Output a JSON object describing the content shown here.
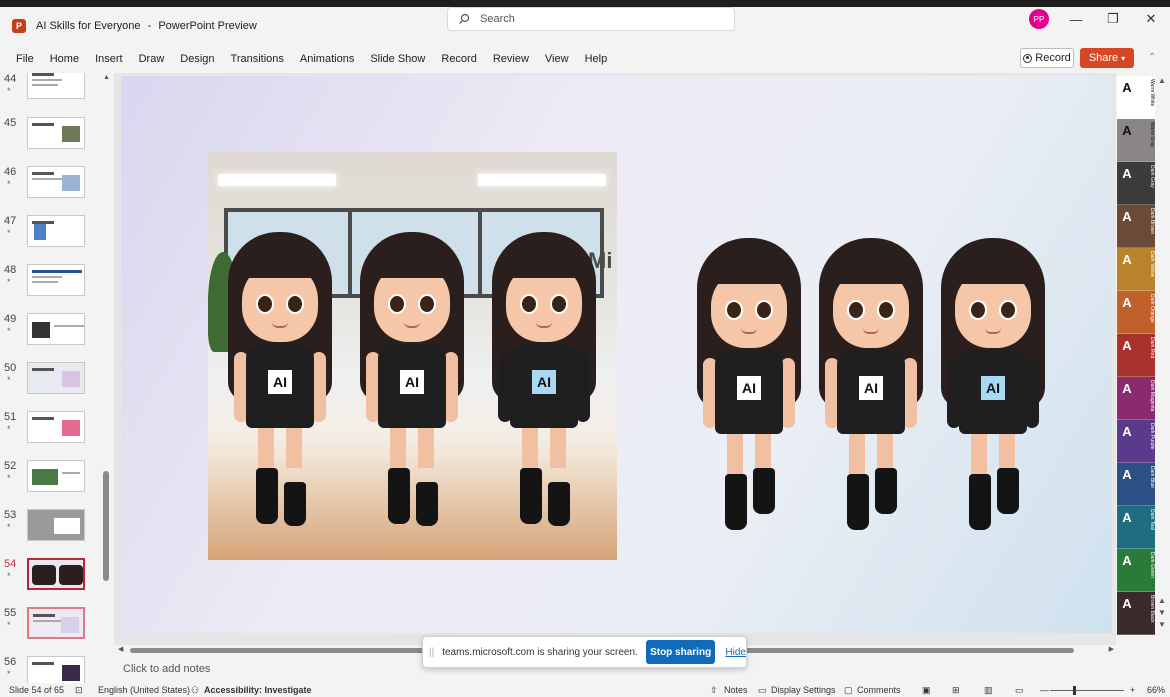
{
  "window": {
    "title": "AI Skills for Everyone",
    "separator": "-",
    "app_name": "PowerPoint Preview",
    "app_icon_letter": "P",
    "search_placeholder": "Search",
    "avatar_initials": "PP",
    "minimize": "—",
    "restore": "❐",
    "close": "✕"
  },
  "ribbon": {
    "tabs": [
      "File",
      "Home",
      "Insert",
      "Draw",
      "Design",
      "Transitions",
      "Animations",
      "Slide Show",
      "Record",
      "Review",
      "View",
      "Help"
    ],
    "record_label": "Record",
    "share_label": "Share",
    "accent": "#d64726"
  },
  "thumbnails": [
    {
      "num": "44",
      "star": "*"
    },
    {
      "num": "45",
      "star": ""
    },
    {
      "num": "46",
      "star": "*"
    },
    {
      "num": "47",
      "star": "*"
    },
    {
      "num": "48",
      "star": "*"
    },
    {
      "num": "49",
      "star": "*"
    },
    {
      "num": "50",
      "star": "*"
    },
    {
      "num": "51",
      "star": "*"
    },
    {
      "num": "52",
      "star": "*"
    },
    {
      "num": "53",
      "star": "*"
    },
    {
      "num": "54",
      "star": "*",
      "selected": true
    },
    {
      "num": "55",
      "star": "*"
    },
    {
      "num": "56",
      "star": "*"
    }
  ],
  "slide": {
    "photo_wall_text": "Mi",
    "logo_text": "AI",
    "figures_left": [
      "AI",
      "AI",
      "AI"
    ],
    "figures_right": [
      "AI",
      "AI",
      "AI"
    ]
  },
  "notes_placeholder": "Click to add notes",
  "share_bar": {
    "grip": "||",
    "message": "teams.microsoft.com is sharing your screen.",
    "stop_label": "Stop sharing",
    "hide_label": "Hide",
    "button_color": "#0f6cbd"
  },
  "swatches": [
    {
      "letter": "A",
      "bg": "#ffffff",
      "fg": "#111111",
      "label": "Warm White"
    },
    {
      "letter": "A",
      "bg": "#8a8686",
      "fg": "#111111",
      "label": "Warm Gray"
    },
    {
      "letter": "A",
      "bg": "#3b3b3b",
      "fg": "#ffffff",
      "label": "Dark Gray"
    },
    {
      "letter": "A",
      "bg": "#6b4a3a",
      "fg": "#ffffff",
      "label": "Dark Brown"
    },
    {
      "letter": "A",
      "bg": "#b8832b",
      "fg": "#ffffff",
      "label": "Dark Yellow"
    },
    {
      "letter": "A",
      "bg": "#c0612b",
      "fg": "#ffffff",
      "label": "Dark Orange"
    },
    {
      "letter": "A",
      "bg": "#a8322e",
      "fg": "#ffffff",
      "label": "Dark Red"
    },
    {
      "letter": "A",
      "bg": "#8a2b6e",
      "fg": "#ffffff",
      "label": "Dark Magenta"
    },
    {
      "letter": "A",
      "bg": "#5a3a8a",
      "fg": "#ffffff",
      "label": "Dark Purple"
    },
    {
      "letter": "A",
      "bg": "#2c4f86",
      "fg": "#ffffff",
      "label": "Dark Blue"
    },
    {
      "letter": "A",
      "bg": "#1f6e80",
      "fg": "#ffffff",
      "label": "Dark Teal"
    },
    {
      "letter": "A",
      "bg": "#2a7a3a",
      "fg": "#ffffff",
      "label": "Dark Green"
    },
    {
      "letter": "A",
      "bg": "#3a2a2a",
      "fg": "#ffffff",
      "label": "Brown Black"
    }
  ],
  "status": {
    "slide_info": "Slide 54 of 65",
    "language": "English (United States)",
    "accessibility": "Accessibility: Investigate",
    "notes": "Notes",
    "display_settings": "Display Settings",
    "comments": "Comments",
    "zoom_minus": "—",
    "zoom_plus": "+",
    "zoom": "66%"
  }
}
